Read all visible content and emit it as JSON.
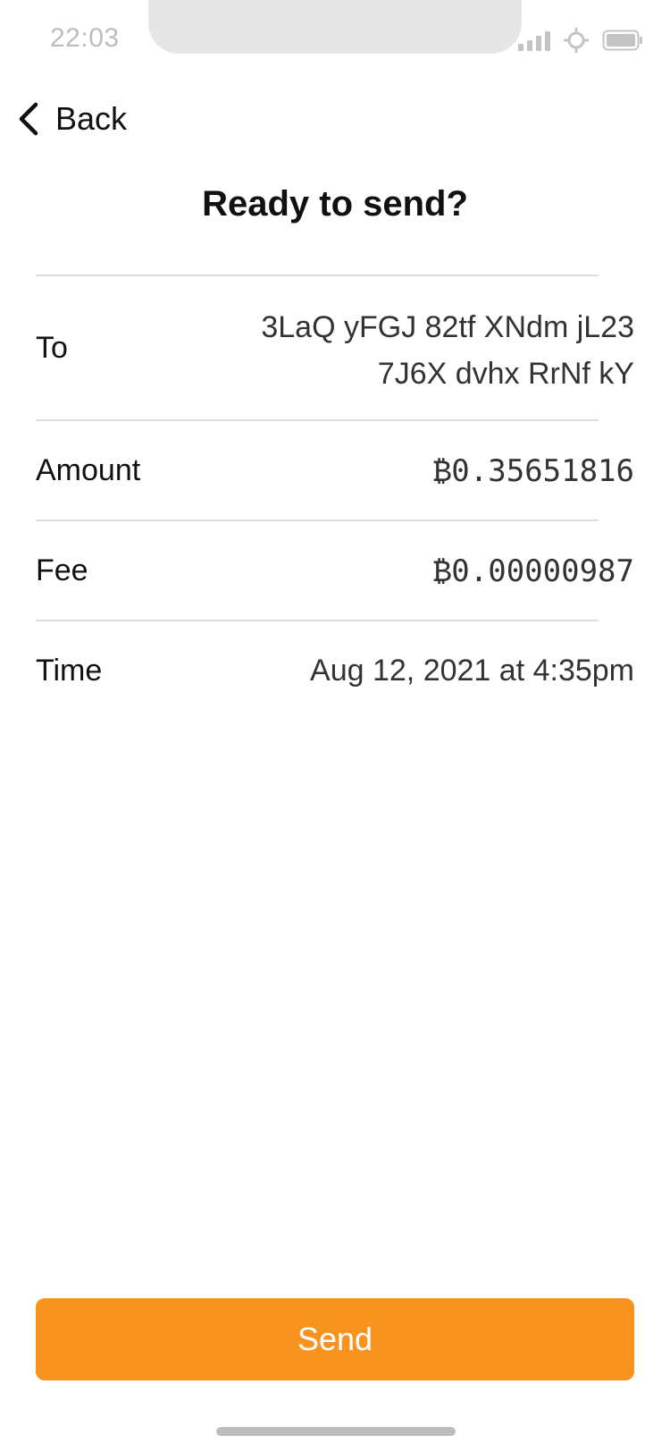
{
  "status_bar": {
    "time": "22:03",
    "icons": [
      "cellular-signal-icon",
      "location-icon",
      "battery-icon"
    ]
  },
  "nav": {
    "back_label": "Back",
    "back_icon": "chevron-left-icon"
  },
  "title": "Ready to send?",
  "details": {
    "to": {
      "label": "To",
      "line1": "3LaQ yFGJ 82tf XNdm jL23",
      "line2": "7J6X dvhx RrNf kY"
    },
    "amount": {
      "label": "Amount",
      "value": "₿0.35651816"
    },
    "fee": {
      "label": "Fee",
      "value": "₿0.00000987"
    },
    "time": {
      "label": "Time",
      "value": "Aug 12, 2021 at 4:35pm"
    }
  },
  "actions": {
    "send_label": "Send"
  },
  "colors": {
    "accent": "#f7931e",
    "divider": "#dedede",
    "status_gray": "#bdbdbd"
  }
}
